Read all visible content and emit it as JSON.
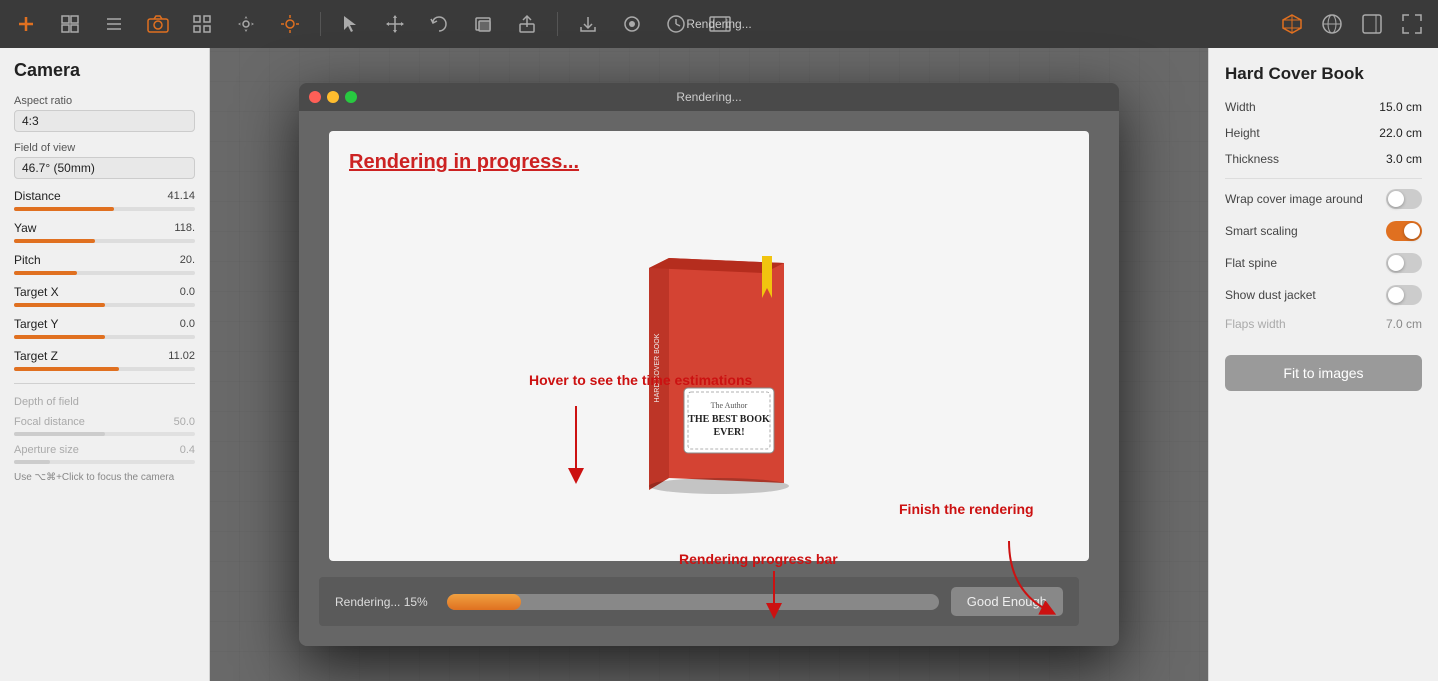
{
  "toolbar": {
    "title": "Rendering...",
    "icons": [
      "add-icon",
      "grid-icon",
      "list-icon",
      "camera-icon",
      "focus-icon",
      "settings-icon",
      "sun-icon",
      "cursor-icon",
      "move-icon",
      "undo-icon",
      "duplicate-icon",
      "export-icon",
      "import-icon",
      "record-icon",
      "clock-icon",
      "film-icon",
      "cube-icon",
      "globe-icon",
      "panel-icon",
      "expand-icon"
    ]
  },
  "left_panel": {
    "title": "Camera",
    "aspect_ratio_label": "Aspect ratio",
    "aspect_ratio_value": "4:3",
    "fov_label": "Field of view",
    "fov_value": "46.7° (50mm)",
    "distance_label": "Distance",
    "distance_value": "41.14",
    "distance_fill": "55",
    "yaw_label": "Yaw",
    "yaw_value": "118.",
    "yaw_fill": "45",
    "pitch_label": "Pitch",
    "pitch_value": "20.",
    "pitch_fill": "35",
    "target_x_label": "Target X",
    "target_x_value": "0.0",
    "target_x_fill": "50",
    "target_y_label": "Target Y",
    "target_y_value": "0.0",
    "target_y_fill": "50",
    "target_z_label": "Target Z",
    "target_z_value": "11.02",
    "target_z_fill": "58",
    "depth_of_field_label": "Depth of field",
    "focal_label": "Focal distance",
    "focal_value": "50.0",
    "focal_fill": "50",
    "aperture_label": "Aperture size",
    "aperture_value": "0.4",
    "aperture_fill": "20",
    "hint": "Use ⌥⌘+Click to focus the camera"
  },
  "modal": {
    "title": "Rendering...",
    "rendering_title": "Rendering in progress...",
    "progress_label": "Rendering... 15%",
    "progress_percent": 15,
    "good_enough_label": "Good Enough"
  },
  "annotations": {
    "hover_text": "Hover to see the time estimations",
    "progress_bar_text": "Rendering progress bar",
    "finish_text": "Finish the rendering"
  },
  "right_panel": {
    "title": "Hard Cover Book",
    "width_label": "Width",
    "width_value": "15.0",
    "width_unit": "cm",
    "height_label": "Height",
    "height_value": "22.0",
    "height_unit": "cm",
    "thickness_label": "Thickness",
    "thickness_value": "3.0",
    "thickness_unit": "cm",
    "wrap_label": "Wrap cover image around",
    "wrap_on": false,
    "smart_scaling_label": "Smart scaling",
    "smart_scaling_on": true,
    "flat_spine_label": "Flat spine",
    "flat_spine_on": false,
    "show_dust_label": "Show dust jacket",
    "show_dust_on": false,
    "flaps_label": "Flaps width",
    "flaps_value": "7.0",
    "flaps_unit": "cm",
    "fit_btn_label": "Fit to images"
  }
}
